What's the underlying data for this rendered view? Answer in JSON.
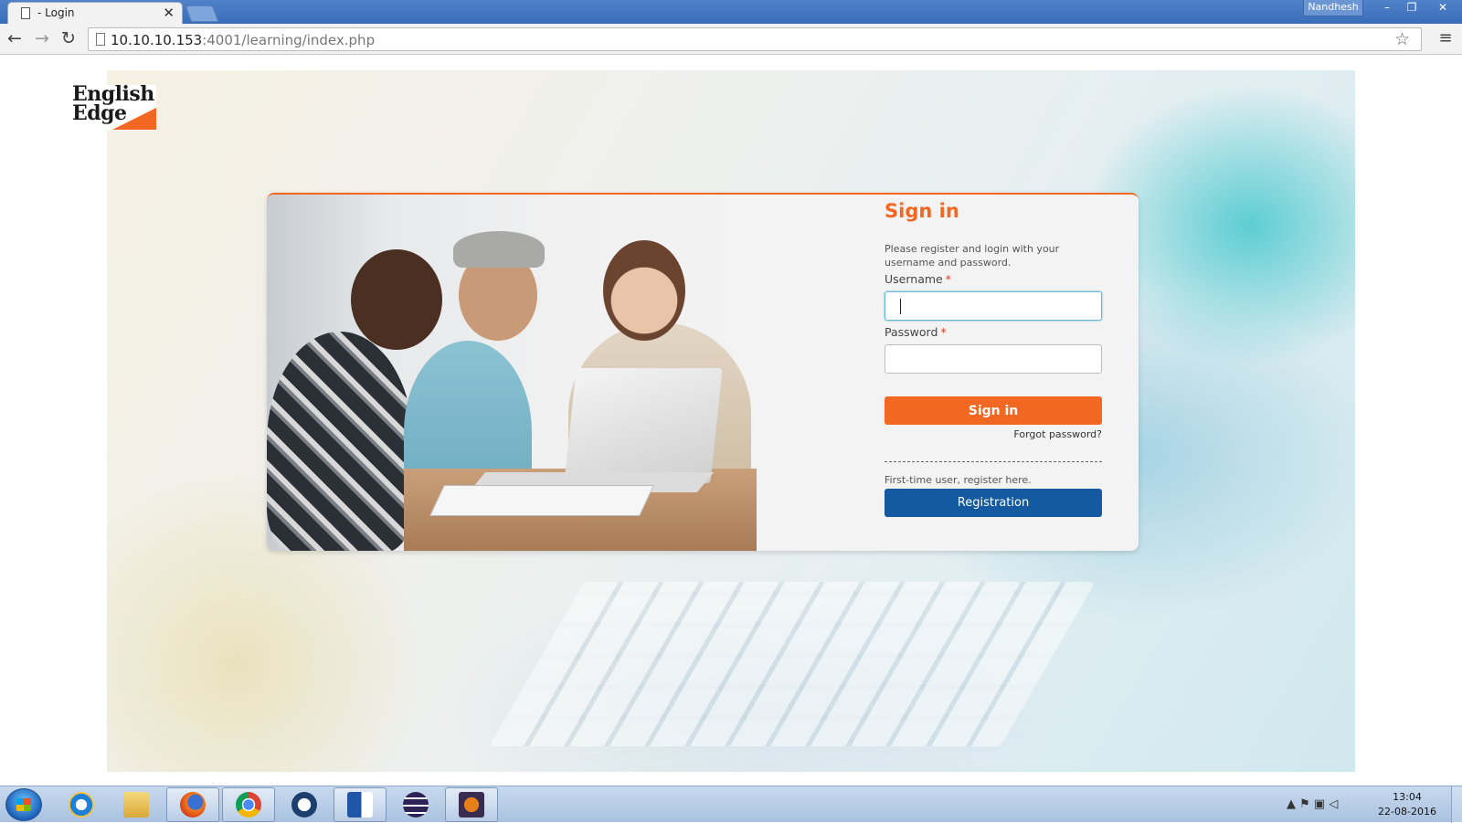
{
  "browser": {
    "tab_title": "- Login",
    "tab_close": "✕",
    "user": "Nandhesh",
    "url_host": "10.10.10.153",
    "url_rest": ":4001/learning/index.php",
    "window_controls": {
      "minimize": "–",
      "restore": "❐",
      "close": "✕"
    },
    "nav": {
      "back": "←",
      "forward": "→",
      "reload": "↻",
      "star": "☆",
      "menu": "≡"
    }
  },
  "logo": {
    "line1": "English",
    "line2": "Edge"
  },
  "signin": {
    "title": "Sign in",
    "intro": "Please register and login with your username and password.",
    "username_label": "Username",
    "password_label": "Password",
    "required_mark": "*",
    "username_value": "",
    "password_value": "",
    "signin_button": "Sign in",
    "forgot_link": "Forgot password?",
    "first_time_text": "First-time user, register here.",
    "registration_button": "Registration"
  },
  "taskbar": {
    "items": [
      "internet-explorer",
      "file-explorer",
      "firefox",
      "chrome",
      "app-tree",
      "word",
      "eclipse",
      "java-ee-ide"
    ],
    "tray": "▲ ⚑ ▣ ◁",
    "time": "13:04",
    "date": "22-08-2016"
  },
  "colors": {
    "accent": "#f26722",
    "registration": "#155aa0",
    "titlebar": "#3a6db8"
  }
}
